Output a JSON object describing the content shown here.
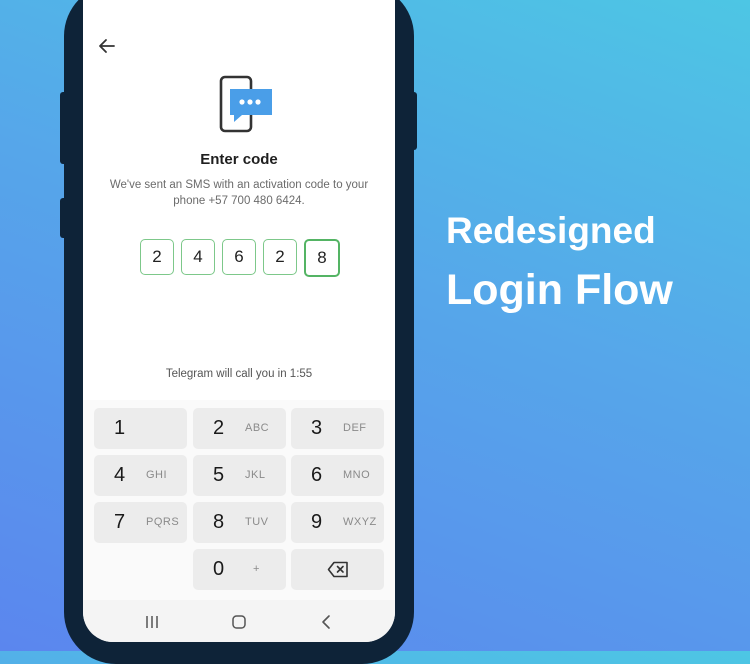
{
  "promo": {
    "line1": "Redesigned",
    "line2": "Login Flow"
  },
  "screen": {
    "title": "Enter code",
    "subtitle": "We've sent an SMS with an activation code to your phone +57 700 480 6424.",
    "code_digits": [
      "2",
      "4",
      "6",
      "2",
      "8"
    ],
    "call_text": "Telegram will call you in 1:55"
  },
  "keypad": {
    "keys": [
      {
        "num": "1",
        "letters": ""
      },
      {
        "num": "2",
        "letters": "ABC"
      },
      {
        "num": "3",
        "letters": "DEF"
      },
      {
        "num": "4",
        "letters": "GHI"
      },
      {
        "num": "5",
        "letters": "JKL"
      },
      {
        "num": "6",
        "letters": "MNO"
      },
      {
        "num": "7",
        "letters": "PQRS"
      },
      {
        "num": "8",
        "letters": "TUV"
      },
      {
        "num": "9",
        "letters": "WXYZ"
      },
      {
        "num": "0",
        "letters": "+"
      }
    ]
  },
  "icons": {
    "back": "arrow-left-icon",
    "sms": "phone-sms-icon",
    "backspace": "backspace-icon",
    "nav_recents": "recent-apps-icon",
    "nav_home": "home-icon",
    "nav_back": "chevron-left-icon"
  },
  "colors": {
    "accent_blue": "#4a9ee8",
    "code_border_green": "#7dc88a",
    "phone_frame": "#0e2338"
  }
}
